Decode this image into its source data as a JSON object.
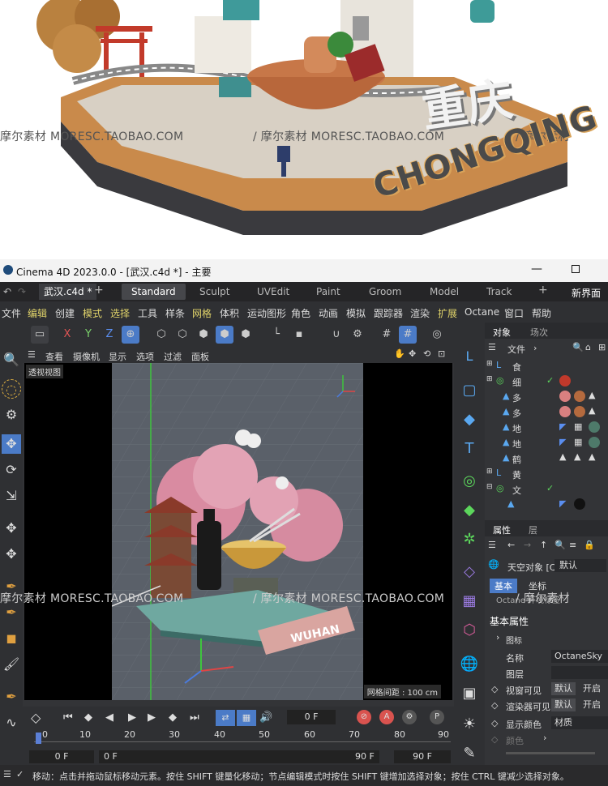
{
  "hero": {
    "title_cn": "重庆",
    "title_en": "CHONGQING",
    "watermark_a": "摩尔素材",
    "watermark_b": "MORESC.TAOBAO.COM"
  },
  "window": {
    "title": "Cinema 4D 2023.0.0 - [武汉.c4d *] - 主要",
    "doc_tab": "武汉.c4d *",
    "new_layout": "新界面"
  },
  "layouts": [
    "Standard",
    "Sculpt",
    "UVEdit",
    "Paint",
    "Groom",
    "Model",
    "Track"
  ],
  "menus": [
    "文件",
    "编辑",
    "创建",
    "模式",
    "选择",
    "工具",
    "样条",
    "网格",
    "体积",
    "运动图形",
    "角色",
    "动画",
    "模拟",
    "跟踪器",
    "渲染",
    "扩展",
    "Octane",
    "窗口",
    "帮助"
  ],
  "toolbar_axes": [
    "X",
    "Y",
    "Z"
  ],
  "viewport": {
    "menu": [
      "查看",
      "摄像机",
      "显示",
      "选项",
      "过滤",
      "面板"
    ],
    "label": "透视视图",
    "grid": "网格间距 : 100 cm",
    "scene_text": "WUHAN"
  },
  "timeline": {
    "ticks": [
      "0",
      "10",
      "20",
      "30",
      "40",
      "50",
      "60",
      "70",
      "80",
      "90"
    ],
    "frame": "0 F",
    "start": "0 F",
    "start2": "0 F",
    "end": "90 F",
    "end2": "90 F"
  },
  "objects": {
    "tabs": [
      "对象",
      "场次"
    ],
    "menu": "文件",
    "rows": [
      "食",
      "细",
      "多",
      "多",
      "地",
      "地",
      "鹤",
      "黄",
      "文"
    ]
  },
  "attributes": {
    "tabs": [
      "属性",
      "层"
    ],
    "obj_type": "天空对象 [C",
    "default": "默认",
    "subtabs": [
      "基本",
      "坐标"
    ],
    "tag": "Octane 环境标签",
    "section": "基本属性",
    "icon_row": "图标",
    "fields": [
      {
        "label": "名称",
        "value": "OctaneSky"
      },
      {
        "label": "图层",
        "value": ""
      },
      {
        "label": "视窗可见",
        "value": "默认",
        "value2": "开启"
      },
      {
        "label": "渲染器可见",
        "value": "默认",
        "value2": "开启"
      },
      {
        "label": "显示颜色",
        "value": "材质"
      },
      {
        "label": "颜色",
        "value": ""
      }
    ]
  },
  "status": "移动：点击并拖动鼠标移动元素。按住 SHIFT 键量化移动；节点编辑模式时按住 SHIFT 键增加选择对象；按住 CTRL 键减少选择对象。"
}
